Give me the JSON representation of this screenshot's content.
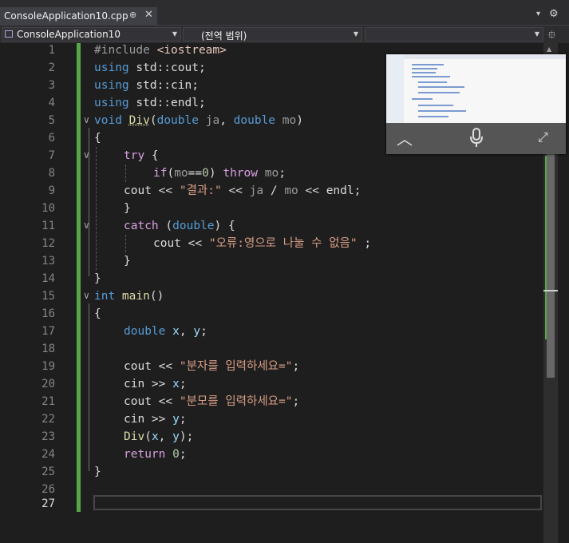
{
  "tab": {
    "title": "ConsoleApplication10.cpp",
    "pin": "⊕",
    "close": "✕"
  },
  "tabstrip": {
    "dropdown": "▾",
    "settings": "⚙"
  },
  "navbar": {
    "project": "ConsoleApplication10",
    "scope": "(전역 범위)",
    "member": "",
    "split": "⯐"
  },
  "lines": {
    "n1": "1",
    "n2": "2",
    "n3": "3",
    "n4": "4",
    "n5": "5",
    "n6": "6",
    "n7": "7",
    "n8": "8",
    "n9": "9",
    "n10": "10",
    "n11": "11",
    "n12": "12",
    "n13": "13",
    "n14": "14",
    "n15": "15",
    "n16": "16",
    "n17": "17",
    "n18": "18",
    "n19": "19",
    "n20": "20",
    "n21": "21",
    "n22": "22",
    "n23": "23",
    "n24": "24",
    "n25": "25",
    "n26": "26",
    "n27": "27"
  },
  "code": {
    "l1": {
      "pre": "#include ",
      "inc": "<iostream>"
    },
    "l2": {
      "kw": "using",
      "rest": " std::cout;"
    },
    "l3": {
      "kw": "using",
      "rest": " std::cin;"
    },
    "l4": {
      "kw": "using",
      "rest": " std::endl;"
    },
    "l5": {
      "kw1": "void",
      "fn": "Div",
      "p1": "(",
      "kw2": "double",
      "a": " ja",
      "c": ", ",
      "kw3": "double",
      "b": " mo",
      "p2": ")"
    },
    "l6": {
      "t": "{"
    },
    "l7": {
      "kw": "try",
      "t": " {"
    },
    "l8": {
      "kw": "if",
      "p": "(",
      "v": "mo",
      "op": "==",
      "num": "0",
      "p2": ") ",
      "kw2": "throw",
      "v2": " mo",
      "t": ";"
    },
    "l9": {
      "a": "cout << ",
      "str": "\"결과:\"",
      "b": " << ",
      "v1": "ja",
      "c": " / ",
      "v2": "mo",
      "d": " << endl;"
    },
    "l10": {
      "t": "}"
    },
    "l11": {
      "kw": "catch",
      "p": " (",
      "kw2": "double",
      "t": ") {"
    },
    "l12": {
      "a": "cout << ",
      "str": "\"오류:영으로 나눌 수 없음\"",
      "b": " ;"
    },
    "l13": {
      "t": "}"
    },
    "l14": {
      "t": "}"
    },
    "l15": {
      "kw": "int",
      "fn": " main",
      "t": "()"
    },
    "l16": {
      "t": "{"
    },
    "l17": {
      "kw": "double",
      "v": " x",
      "c": ", ",
      "v2": "y",
      "t": ";"
    },
    "l18": {
      "t": ""
    },
    "l19": {
      "a": "cout << ",
      "str": "\"분자를 입력하세요=\"",
      "t": ";"
    },
    "l20": {
      "a": "cin >> ",
      "v": "x",
      "t": ";"
    },
    "l21": {
      "a": "cout << ",
      "str": "\"분모를 입력하세요=\"",
      "t": ";"
    },
    "l22": {
      "a": "cin >> ",
      "v": "y",
      "t": ";"
    },
    "l23": {
      "fn": "Div",
      "p": "(",
      "v": "x",
      "c": ", ",
      "v2": "y",
      "t": ");"
    },
    "l24": {
      "kw": "return",
      "num": " 0",
      "t": ";"
    },
    "l25": {
      "t": "}"
    },
    "l26": {
      "t": ""
    },
    "l27": {
      "t": ""
    }
  },
  "pip": {
    "up_icon": "︿",
    "expand_icon": "⤢"
  },
  "colors": {
    "accent_green": "#57a64a",
    "keyword": "#569cd6",
    "string": "#d69d85",
    "control": "#d8a0df"
  }
}
